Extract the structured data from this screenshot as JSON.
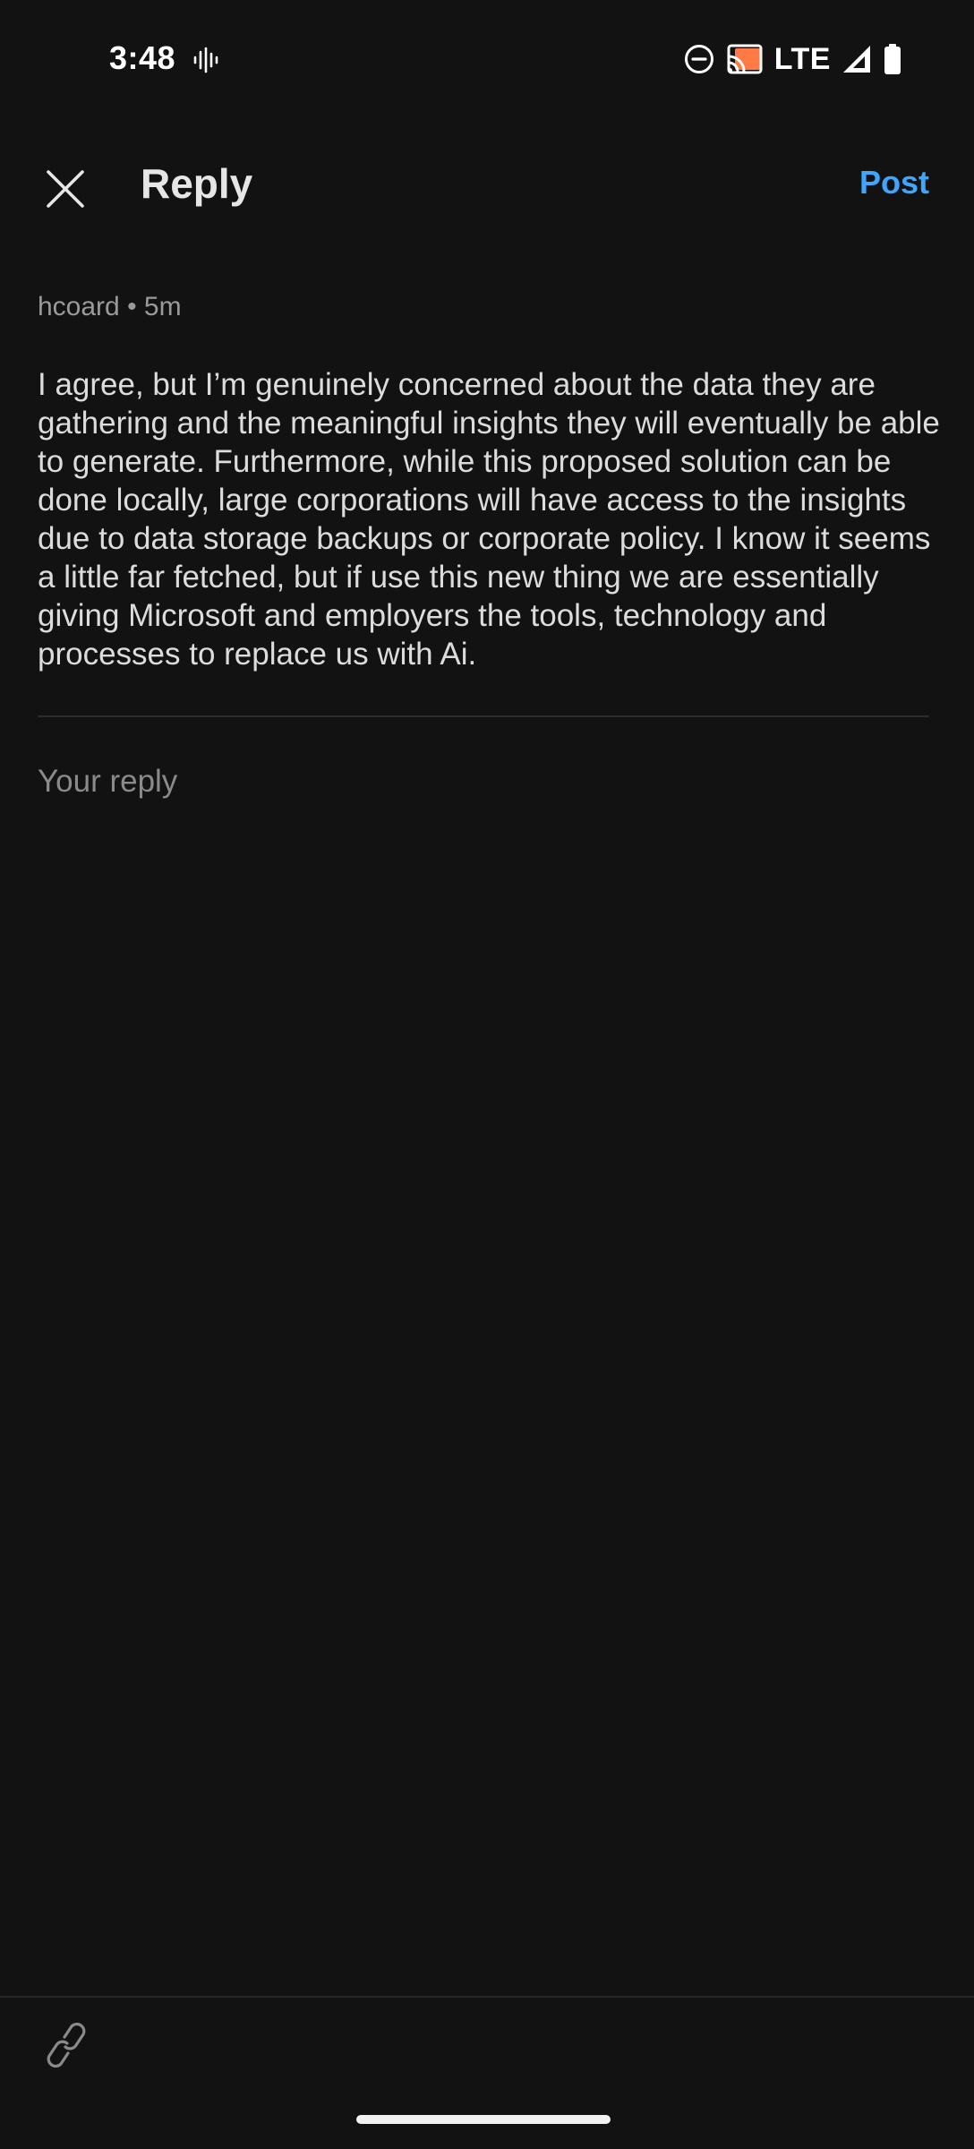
{
  "status_bar": {
    "time": "3:48",
    "network": "LTE",
    "icons": [
      "voice-wave-icon",
      "do-not-disturb-icon",
      "cast-icon",
      "signal-icon",
      "battery-icon"
    ],
    "cast_color": "#ff7a45"
  },
  "app_bar": {
    "close_icon": "close-icon",
    "title": "Reply",
    "post_label": "Post"
  },
  "comment": {
    "meta": "hcoard • 5m",
    "text": "I agree, but I’m genuinely concerned about the data they are gathering and the meaningful insights they will eventually be able to generate. Furthermore, while this proposed solution can be done locally, large corporations will have access to the insights due to data storage backups or corporate policy. I know it seems a little far fetched, but if use this new thing we are essentially giving Microsoft and employers the tools, technology and processes to replace us with Ai."
  },
  "reply": {
    "value": "",
    "placeholder": "Your reply"
  },
  "bottom_bar": {
    "attach_icon": "link-icon"
  },
  "colors": {
    "background": "#121212",
    "accent": "#3ea6ff",
    "text_primary": "#dcdcdc",
    "text_secondary": "#9a9a9a"
  }
}
